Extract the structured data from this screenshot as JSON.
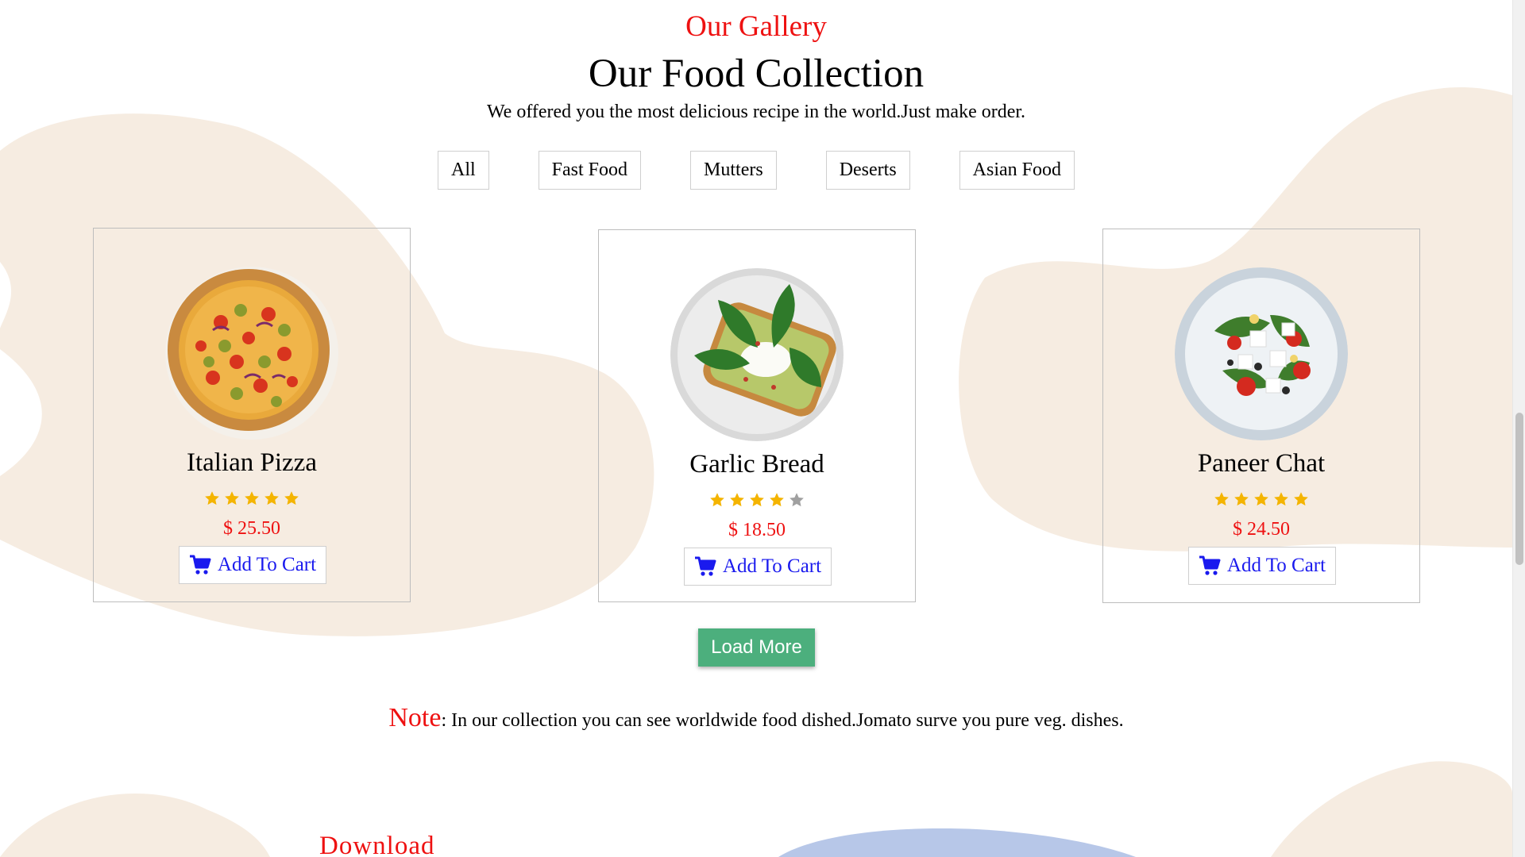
{
  "gallery": {
    "subtitle": "Our Gallery",
    "title": "Our Food Collection",
    "description": "We offered you the most delicious recipe in the world.Just make order."
  },
  "filters": [
    {
      "label": "All"
    },
    {
      "label": "Fast Food"
    },
    {
      "label": "Mutters"
    },
    {
      "label": "Deserts"
    },
    {
      "label": "Asian Food"
    }
  ],
  "products": [
    {
      "name": "Italian Pizza",
      "rating": 5,
      "rating_max": 5,
      "price": "$ 25.50",
      "cart_label": "Add To Cart",
      "image_icon": "pizza-image"
    },
    {
      "name": "Garlic Bread",
      "rating": 4,
      "rating_max": 5,
      "price": "$ 18.50",
      "cart_label": "Add To Cart",
      "image_icon": "garlic-bread-image"
    },
    {
      "name": "Paneer Chat",
      "rating": 5,
      "rating_max": 5,
      "price": "$ 24.50",
      "cart_label": "Add To Cart",
      "image_icon": "salad-image"
    }
  ],
  "load_more_label": "Load More",
  "note": {
    "label": "Note",
    "text": ": In our collection you can see worldwide food dished.Jomato surve you pure veg. dishes."
  },
  "download_heading": "Download",
  "colors": {
    "accent_red": "#ee1111",
    "cart_blue": "#1a1aee",
    "load_more_green": "#4caf7d",
    "star_filled": "#f4b400",
    "star_empty": "#a0a0a0",
    "blob_beige": "#f6ece1",
    "blob_blue": "#b7c7e8"
  }
}
